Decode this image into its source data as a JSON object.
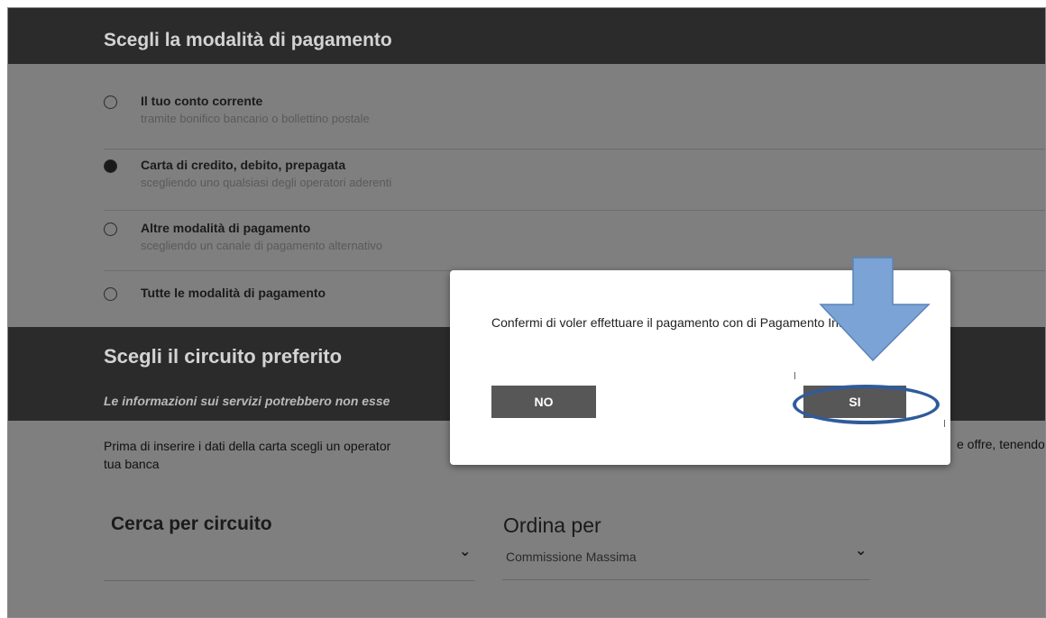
{
  "sections": {
    "payment_title": "Scegli la modalità di pagamento",
    "circuit_title": "Scegli il circuito preferito",
    "circuit_notice": "Le informazioni sui servizi potrebbero non esse"
  },
  "payment_options": [
    {
      "label": "Il tuo conto corrente",
      "sub": "tramite bonifico bancario o bollettino postale",
      "selected": false
    },
    {
      "label": "Carta di credito, debito, prepagata",
      "sub": "scegliendo uno qualsiasi degli operatori aderenti",
      "selected": true
    },
    {
      "label": "Altre modalità di pagamento",
      "sub": "scegliendo un canale di pagamento alternativo",
      "selected": false
    },
    {
      "label": "Tutte le modalità di pagamento",
      "sub": "",
      "selected": false
    }
  ],
  "body_text": {
    "line1": "Prima di inserire i dati della carta scegli un operator",
    "line1_right": "e offre, tenendo",
    "line2": "tua banca"
  },
  "search": {
    "title": "Cerca per circuito"
  },
  "sort": {
    "title": "Ordina per",
    "selected": "Commissione Massima"
  },
  "modal": {
    "message": "Confermi di voler effettuare il pagamento con      di Pagamento InfoCamere?",
    "no_label": "NO",
    "yes_label": "SI"
  },
  "colors": {
    "dark_band": "#2b2b2b",
    "overlay_bg": "#7f7f7f",
    "button": "#575757",
    "highlight": "#2f5b9a",
    "arrow": "#7ba3d6"
  }
}
